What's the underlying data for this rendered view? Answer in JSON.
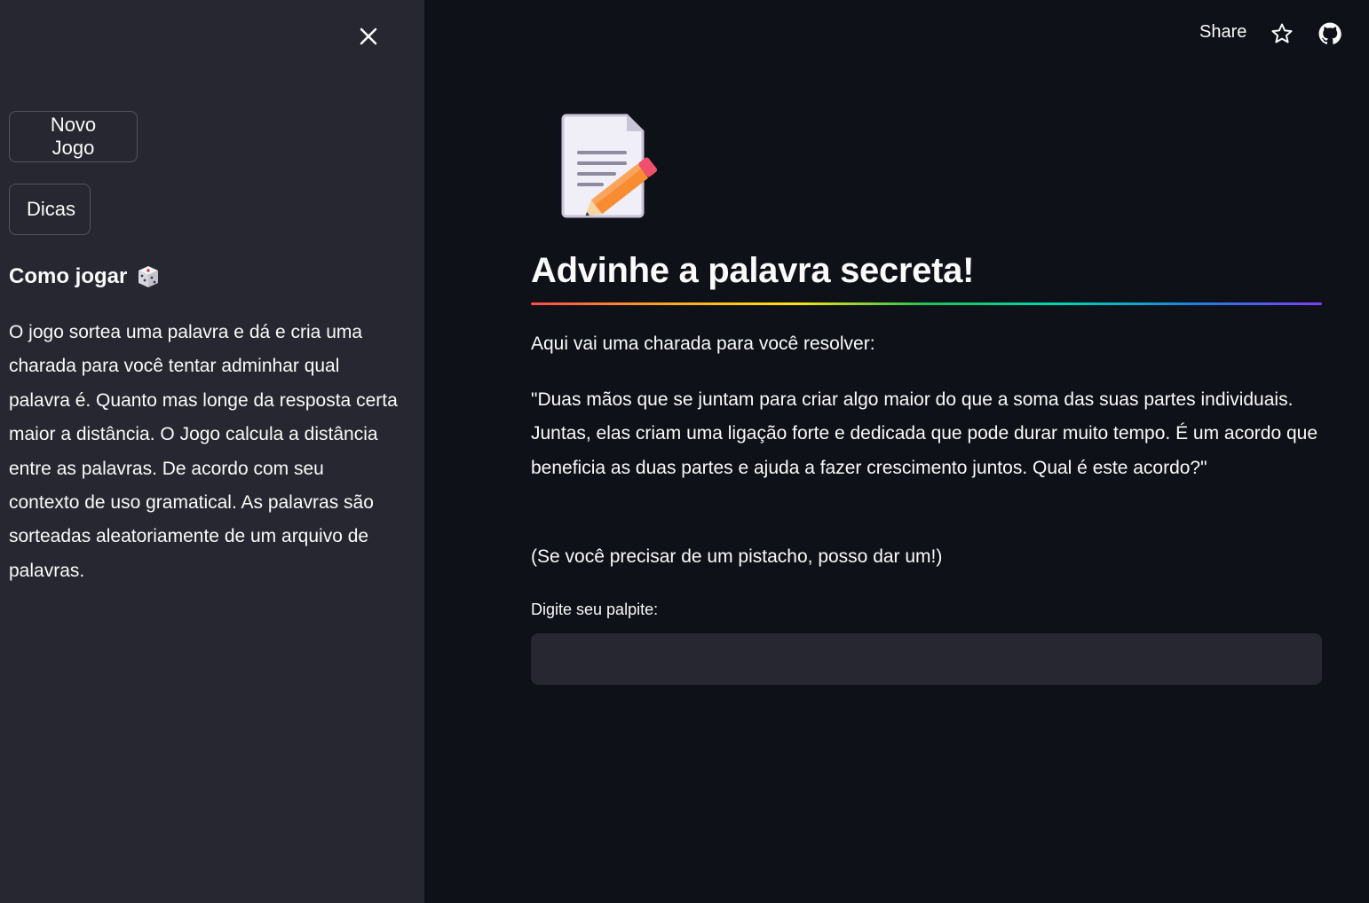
{
  "sidebar": {
    "close_icon": "close-icon",
    "new_game_label": "Novo Jogo",
    "tips_label": "Dicas",
    "how_to_title": "Como jogar",
    "how_to_icon": "dice-icon",
    "how_to_text": "O jogo sortea uma palavra e dá e cria uma charada para você tentar adminhar qual palavra é. Quanto mas longe da resposta certa maior a distância. O Jogo calcula a distância entre as palavras. De acordo com seu contexto de uso gramatical. As palavras são sorteadas aleatoriamente de um arquivo de palavras."
  },
  "header": {
    "share_label": "Share",
    "star_icon": "star-icon",
    "github_icon": "github-icon"
  },
  "main": {
    "hero_icon": "memo-pencil-icon",
    "title": "Advinhe a palavra secreta!",
    "intro": "Aqui vai uma charada para você resolver:",
    "riddle": "\"Duas mãos que se juntam para criar algo maior do que a soma das suas partes individuais. Juntas, elas criam uma ligação forte e dedicada que pode durar muito tempo. É um acordo que beneficia as duas partes e ajuda a fazer crescimento juntos. Qual é este acordo?\"",
    "hint_note": "(Se você precisar de um pistacho, posso dar um!)",
    "input_label": "Digite seu palpite:",
    "input_value": "",
    "input_placeholder": ""
  },
  "colors": {
    "background": "#0e1117",
    "sidebar": "#262730",
    "text": "#fafafa",
    "input_bg": "#262730"
  }
}
